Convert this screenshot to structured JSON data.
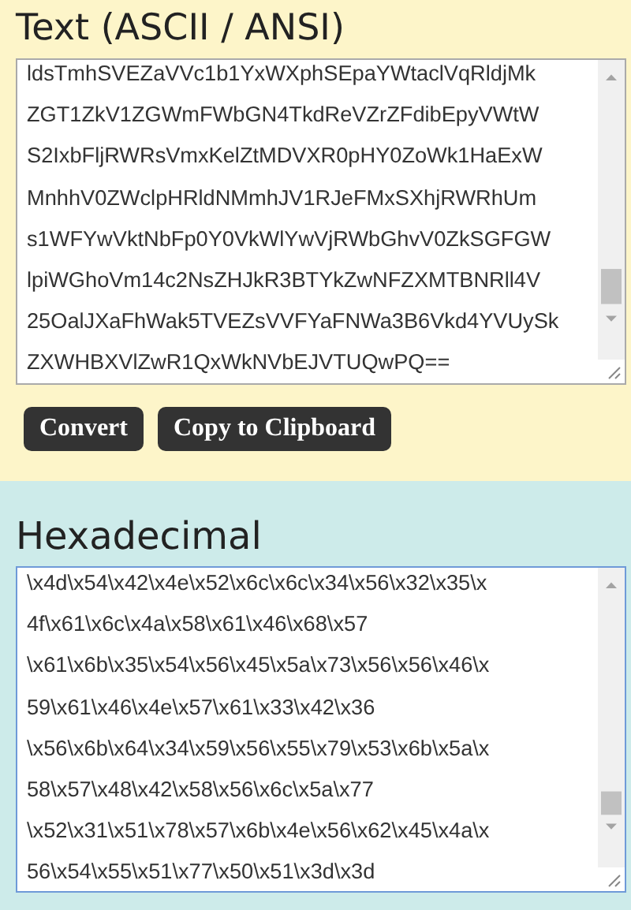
{
  "text_section": {
    "title": "Text (ASCII / ANSI)",
    "field_lines": [
      "ldsTmhSVEZaVVc1b1YxWXphSEpaYWtaclVqRldjMk",
      "ZGT1ZkV1ZGWmFWbGN4TkdReVZrZFdibEpyVWtW",
      "S2IxbFljRWRsVmxKelZtMDVXR0pHY0ZoWk1HaExW",
      "MnhhV0ZWclpHRldNMmhJV1RJeFMxSXhjRWRhUm",
      "s1WFYwVktNbFp0Y0VkWlYwVjRWbGhvV0ZkSGFGW",
      "lpiWGhoVm14c2NsZHJkR3BTYkZwNFZXMTBNRll4V",
      "25OalJXaFhWak5TVEZsVVFYaFNWa3B6Vkd4YVUySk",
      "ZXWHBXVlZwR1QxWkNVbEJVTUQwPQ=="
    ]
  },
  "buttons": [
    {
      "label": "Convert"
    },
    {
      "label": "Copy to Clipboard"
    }
  ],
  "hex_section": {
    "title": "Hexadecimal",
    "focused": true,
    "field_lines": [
      "\\x4d\\x54\\x42\\x4e\\x52\\x6c\\x6c\\x34\\x56\\x32\\x35\\x",
      "4f\\x61\\x6c\\x4a\\x58\\x61\\x46\\x68\\x57",
      "\\x61\\x6b\\x35\\x54\\x56\\x45\\x5a\\x73\\x56\\x56\\x46\\x",
      "59\\x61\\x46\\x4e\\x57\\x61\\x33\\x42\\x36",
      "\\x56\\x6b\\x64\\x34\\x59\\x56\\x55\\x79\\x53\\x6b\\x5a\\x",
      "58\\x57\\x48\\x42\\x58\\x56\\x6c\\x5a\\x77",
      "\\x52\\x31\\x51\\x78\\x57\\x6b\\x4e\\x56\\x62\\x45\\x4a\\x",
      "56\\x54\\x55\\x51\\x77\\x50\\x51\\x3d\\x3d"
    ]
  }
}
